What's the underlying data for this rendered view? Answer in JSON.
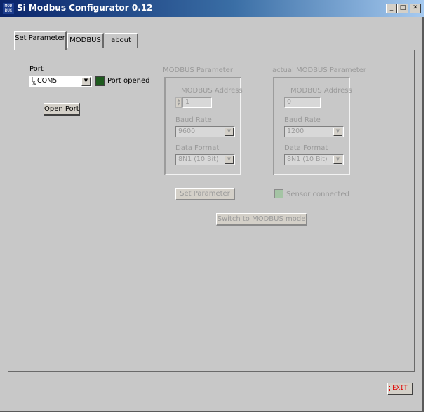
{
  "window": {
    "title": "Si Modbus Configurator 0.12",
    "app_icon_lines": [
      "MOD",
      "BUS"
    ]
  },
  "tabs": [
    {
      "label": "Set Parameter",
      "active": true
    },
    {
      "label": "MODBUS",
      "active": false
    },
    {
      "label": "about",
      "active": false
    }
  ],
  "port": {
    "label": "Port",
    "value": "COM5",
    "status_label": "Port opened",
    "open_button": "Open Port"
  },
  "modbus_parameter": {
    "heading": "MODBUS Parameter",
    "address_label": "MODBUS Address",
    "address_value": "1",
    "baud_label": "Baud Rate",
    "baud_value": "9600",
    "format_label": "Data Format",
    "format_value": "8N1 (10 Bit)",
    "set_button": "Set Parameter"
  },
  "actual_parameter": {
    "heading": "actual MODBUS Parameter",
    "address_label": "MODBUS Address",
    "address_value": "0",
    "baud_label": "Baud Rate",
    "baud_value": "1200",
    "format_label": "Data Format",
    "format_value": "8N1 (10 Bit)",
    "sensor_label": "Sensor connected"
  },
  "switch_button": "Switch to MODBUS mode",
  "exit_button": "EXIT",
  "colors": {
    "led_port": "#1e5a1e",
    "led_sensor": "#a4c4a4",
    "exit": "#e00000",
    "title_bar": "#0a246a"
  }
}
